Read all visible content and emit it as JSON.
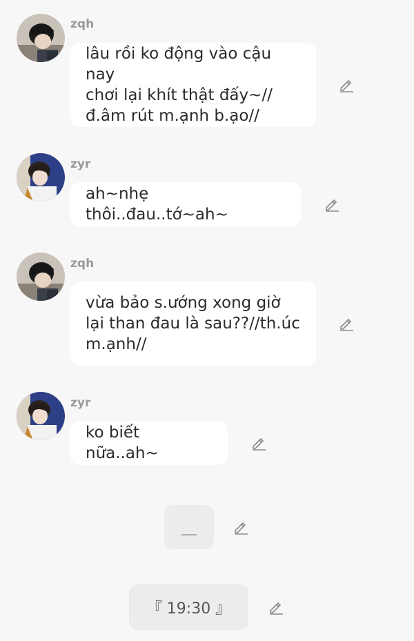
{
  "messages": [
    {
      "username": "zqh",
      "text": "lâu rồi ko động vào cậu nay\nchơi lại khít thật đấy~//\nđ.âm rút m.ạnh b.ạo//",
      "avatar": "avatar-zqh"
    },
    {
      "username": "zyr",
      "text": "ah~nhẹ thôi..đau..tớ~ah~",
      "avatar": "avatar-zyr"
    },
    {
      "username": "zqh",
      "text": "vừa bảo s.ướng xong giờ\nlại than đau là sau??//th.úc\nm.ạnh//",
      "avatar": "avatar-zqh"
    },
    {
      "username": "zyr",
      "text": "ko biết nữa..ah~",
      "avatar": "avatar-zyr"
    }
  ],
  "system_messages": [
    {
      "text": "＿"
    },
    {
      "text": "『 19:30 』"
    }
  ],
  "colors": {
    "background": "#f7f7f7",
    "bubble": "#ffffff",
    "system_bubble": "#ececec",
    "username": "#9a9a9a",
    "text": "#2b2b2b",
    "icon": "#8a8a8a"
  },
  "icons": {
    "edit": "pencil-edit-icon"
  }
}
